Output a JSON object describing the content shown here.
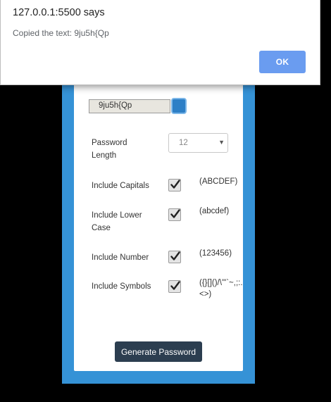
{
  "alert": {
    "title": "127.0.0.1:5500 says",
    "message": "Copied the text: 9ju5h{Qp",
    "ok_label": "OK",
    "ok_color": "#6a9cf0"
  },
  "generator": {
    "password_value": "9ju5h{Qp",
    "copy_button_icon": "clipboard-icon",
    "length": {
      "label": "Password Length",
      "selected": "12"
    },
    "options": [
      {
        "label": "Include Capitals",
        "checked": true,
        "hint": "(ABCDEF)"
      },
      {
        "label": "Include Lower Case",
        "checked": true,
        "hint": "(abcdef)"
      },
      {
        "label": "Include Number",
        "checked": true,
        "hint": "(123456)"
      },
      {
        "label": "Include Symbols",
        "checked": true,
        "hint": "({}[]()/\\'\"`~,;:.<>)"
      }
    ],
    "generate_label": "Generate Password"
  },
  "colors": {
    "frame": "#3592d6",
    "button_dark": "#2c3e50",
    "copy_button": "#2d7fc6"
  }
}
